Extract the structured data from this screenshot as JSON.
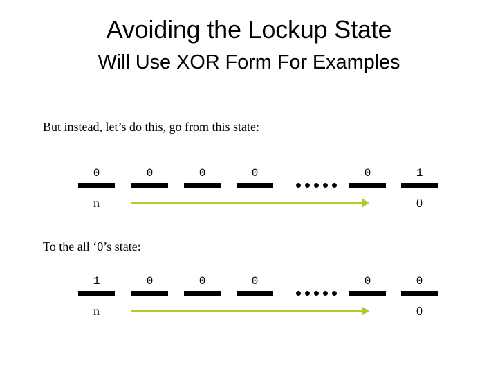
{
  "slide": {
    "title": "Avoiding the Lockup State",
    "subtitle": "Will Use XOR Form For Examples",
    "accent_color": "#AFCB33",
    "bar_color": "#000000",
    "background_color": "#FFFFFF"
  },
  "section1": {
    "caption": "But instead, let’s do this, go from this state:",
    "bits": [
      "0",
      "0",
      "0",
      "0",
      "0",
      "1"
    ],
    "ellipsis_dots": 5,
    "ellipsis_after_index": 3,
    "left_label": "n",
    "right_label": "0",
    "arrow_direction": "right"
  },
  "section2": {
    "caption": "To the all ‘0’s state:",
    "bits": [
      "1",
      "0",
      "0",
      "0",
      "0",
      "0"
    ],
    "ellipsis_dots": 5,
    "ellipsis_after_index": 3,
    "left_label": "n",
    "right_label": "0",
    "arrow_direction": "right"
  }
}
